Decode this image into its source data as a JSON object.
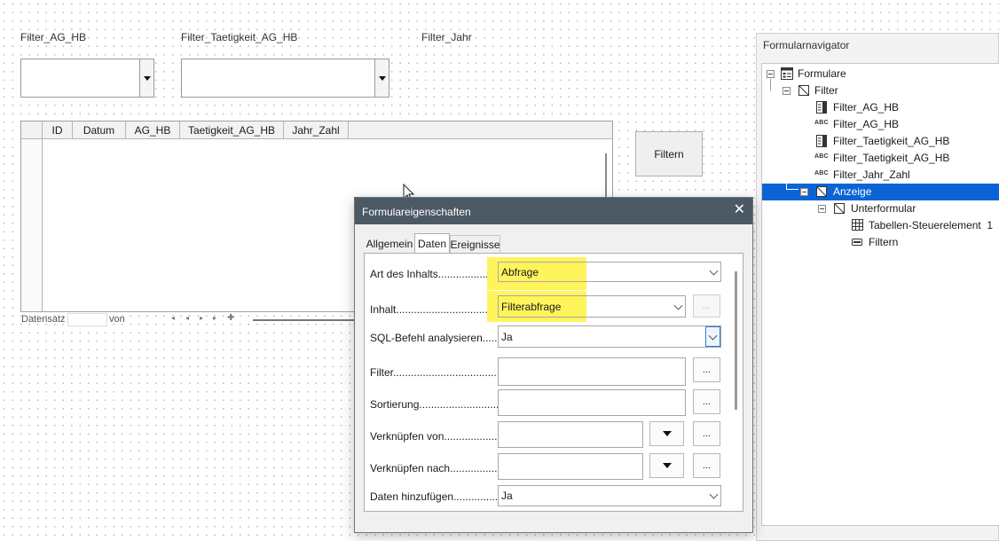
{
  "form": {
    "labels": {
      "filter_ag_hb": "Filter_AG_HB",
      "filter_taetigkeit": "Filter_Taetigkeit_AG_HB",
      "filter_jahr": "Filter_Jahr"
    },
    "grid": {
      "columns": [
        "ID",
        "Datum",
        "AG_HB",
        "Taetigkeit_AG_HB",
        "Jahr_Zahl"
      ],
      "record_label": "Datensatz",
      "of_label": "von"
    },
    "filter_button": "Filtern"
  },
  "navigator": {
    "title": "Formularnavigator",
    "items": [
      {
        "label": "Formulare",
        "icon": "forms-root-icon"
      },
      {
        "label": "Filter",
        "icon": "form-icon"
      },
      {
        "label": "Filter_AG_HB",
        "icon": "listbox-icon"
      },
      {
        "label": "Filter_AG_HB",
        "icon": "label-field-icon"
      },
      {
        "label": "Filter_Taetigkeit_AG_HB",
        "icon": "listbox-icon"
      },
      {
        "label": "Filter_Taetigkeit_AG_HB",
        "icon": "label-field-icon"
      },
      {
        "label": "Filter_Jahr_Zahl",
        "icon": "label-field-icon"
      },
      {
        "label": "Anzeige",
        "icon": "form-icon"
      },
      {
        "label": "Unterformular",
        "icon": "form-icon"
      },
      {
        "label": "Tabellen-Steuerelement  1",
        "icon": "table-control-icon"
      },
      {
        "label": "Filtern",
        "icon": "push-button-icon"
      }
    ],
    "abc_glyph": "ABC"
  },
  "dialog": {
    "title": "Formulareigenschaften",
    "close_glyph": "✕",
    "tabs": [
      "Allgemein",
      "Daten",
      "Ereignisse"
    ],
    "properties": {
      "art_des_inhalts": {
        "label": "Art des Inhalts......................",
        "value": "Abfrage"
      },
      "inhalt": {
        "label": "Inhalt..........................................",
        "value": "Filterabfrage"
      },
      "sql": {
        "label": "SQL-Befehl analysieren.......",
        "value": "Ja"
      },
      "filter": {
        "label": "Filter...........................................",
        "value": ""
      },
      "sortierung": {
        "label": "Sortierung...................................",
        "value": ""
      },
      "verkn_von": {
        "label": "Verknüpfen von..................",
        "value": ""
      },
      "verkn_nach": {
        "label": "Verknüpfen nach................",
        "value": ""
      },
      "daten_hinzu": {
        "label": "Daten hinzufügen...............",
        "value": "Ja"
      }
    },
    "dots": "..."
  },
  "colors": {
    "highlight": "#fff45c",
    "selection": "#0a64d4",
    "titlebar": "#4b5965"
  }
}
